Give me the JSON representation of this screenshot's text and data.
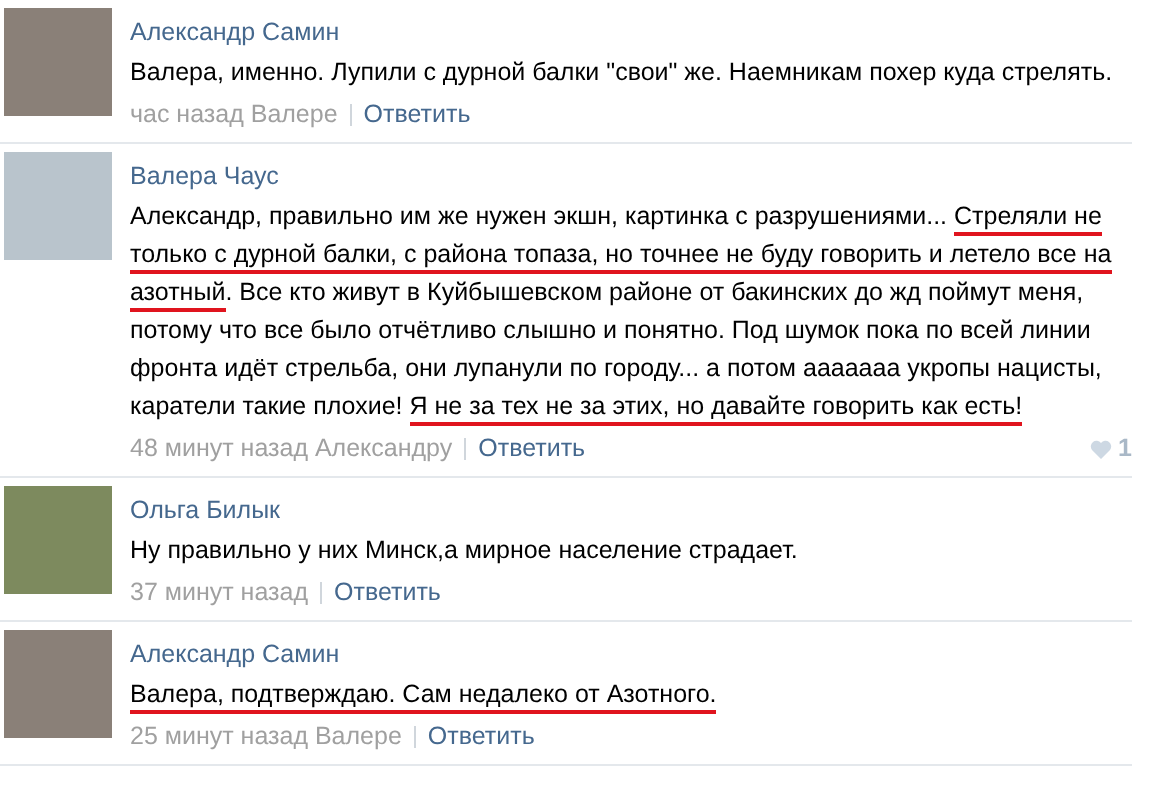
{
  "comments": [
    {
      "author": "Александр Самин",
      "segments": [
        {
          "text": "Валера, именно. Лупили с дурной балки \"свои\" же. Наемникам похер куда стрелять.",
          "underlined": false
        }
      ],
      "time": "час назад Валере",
      "reply": "Ответить"
    },
    {
      "author": "Валера Чаус",
      "segments": [
        {
          "text": "Александр, правильно им же нужен экшн, картинка с разрушениями... ",
          "underlined": false
        },
        {
          "text": "Стреляли не только с дурной балки, с района топаза, но точнее не буду говорить и летело все на азотный",
          "underlined": true
        },
        {
          "text": ". Все кто живут в Куйбышевском районе от бакинских до жд поймут меня, потому что все было отчётливо слышно и понятно. Под шумок пока по всей линии фронта идёт стрельба, они лупанули по городу... а потом ааааааа укропы нацисты, каратели такие плохие! ",
          "underlined": false
        },
        {
          "text": "Я не за тех не за этих, но давайте говорить как есть!",
          "underlined": true
        }
      ],
      "time": "48 минут назад Александру",
      "reply": "Ответить",
      "likes": "1"
    },
    {
      "author": "Ольга Билык",
      "segments": [
        {
          "text": "Ну правильно у них Минск,а мирное население страдает.",
          "underlined": false
        }
      ],
      "time": "37 минут назад",
      "reply": "Ответить"
    },
    {
      "author": "Александр Самин",
      "segments": [
        {
          "text": "Валера, подтверждаю. Сам недалеко от Азотного.",
          "underlined": true
        }
      ],
      "time": "25 минут назад Валере",
      "reply": "Ответить"
    }
  ]
}
